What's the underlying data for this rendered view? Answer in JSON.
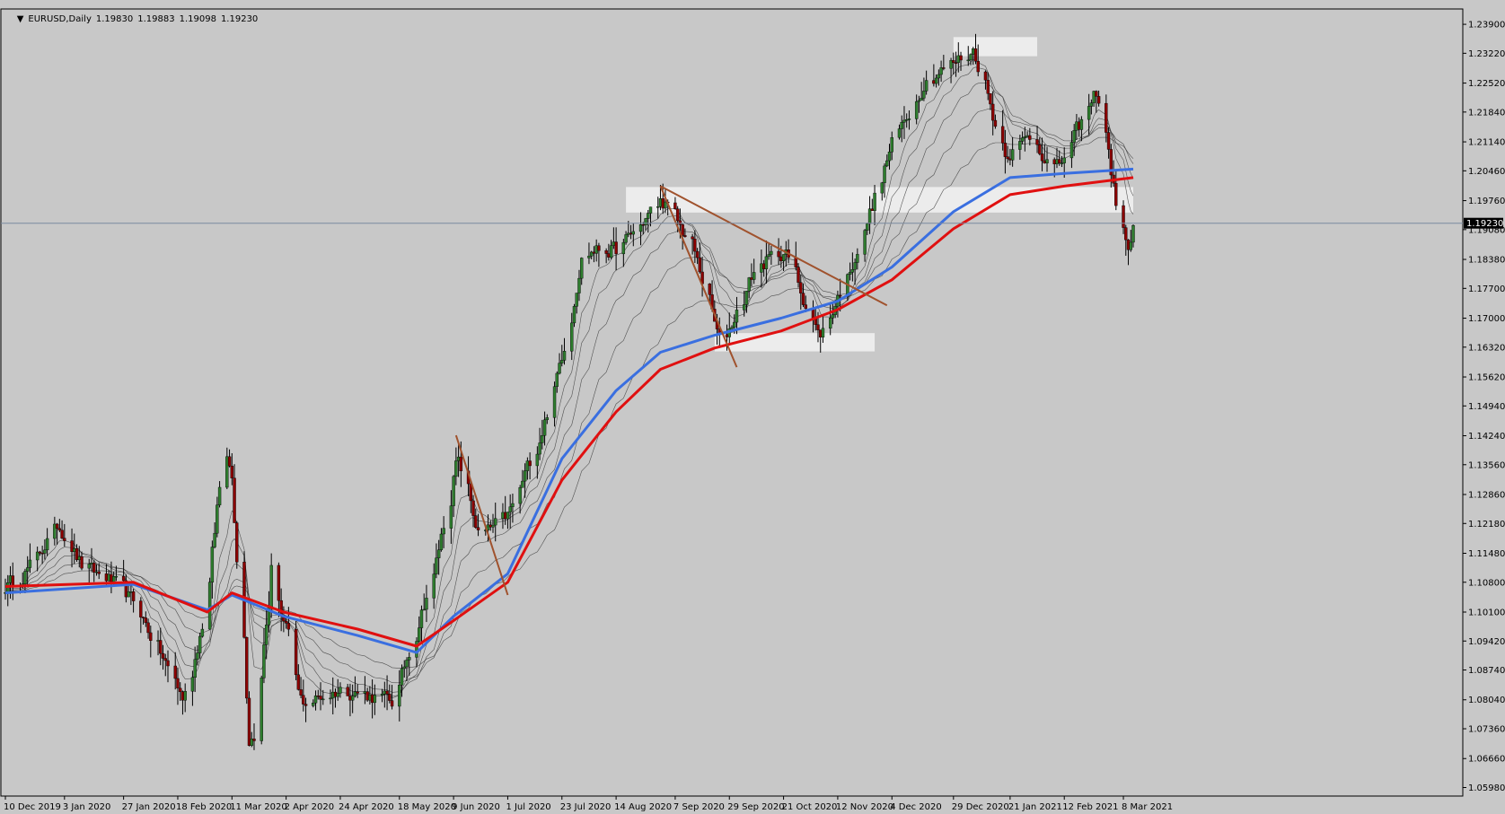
{
  "header": {
    "symbol": "EURUSD,Daily",
    "open": "1.19830",
    "high": "1.19883",
    "low": "1.19098",
    "close": "1.19230"
  },
  "colors": {
    "background": "#c8c8c8",
    "bull_candle": "#2e7d2e",
    "bear_candle": "#8b0000",
    "wick": "#000000",
    "ema_blue": "#3a6fe0",
    "ema_red": "#e01010",
    "ribbon": "#333333",
    "trendline": "#a0522d",
    "zone": "#ececec",
    "price_line": "#7a8aa0"
  },
  "chart_data": {
    "type": "candlestick",
    "title": "EURUSD,Daily",
    "ylim": [
      1.0578,
      1.2426
    ],
    "y_ticks": [
      "1.23900",
      "1.23220",
      "1.22520",
      "1.21840",
      "1.21140",
      "1.20460",
      "1.19760",
      "1.19080",
      "1.18380",
      "1.17700",
      "1.17000",
      "1.16320",
      "1.15620",
      "1.14940",
      "1.14240",
      "1.13560",
      "1.12860",
      "1.12180",
      "1.11480",
      "1.10800",
      "1.10100",
      "1.09420",
      "1.08740",
      "1.08040",
      "1.07360",
      "1.06660",
      "1.05980"
    ],
    "x_ticks": [
      "10 Dec 2019",
      "3 Jan 2020",
      "27 Jan 2020",
      "18 Feb 2020",
      "11 Mar 2020",
      "2 Apr 2020",
      "24 Apr 2020",
      "18 May 2020",
      "9 Jun 2020",
      "1 Jul 2020",
      "23 Jul 2020",
      "14 Aug 2020",
      "7 Sep 2020",
      "29 Sep 2020",
      "21 Oct 2020",
      "12 Nov 2020",
      "4 Dec 2020",
      "29 Dec 2020",
      "21 Jan 2021",
      "12 Feb 2021",
      "8 Mar 2021"
    ],
    "current_price": "1.19230",
    "price_path": [
      {
        "date": "10 Dec 2019",
        "price": 1.107
      },
      {
        "date": "20 Dec 2019",
        "price": 1.112
      },
      {
        "date": "31 Dec 2019",
        "price": 1.122
      },
      {
        "date": "10 Jan 2020",
        "price": 1.111
      },
      {
        "date": "20 Jan 2020",
        "price": 1.109
      },
      {
        "date": "31 Jan 2020",
        "price": 1.103
      },
      {
        "date": "20 Feb 2020",
        "price": 1.08
      },
      {
        "date": "28 Feb 2020",
        "price": 1.1
      },
      {
        "date": "09 Mar 2020",
        "price": 1.148
      },
      {
        "date": "18 Mar 2020",
        "price": 1.066
      },
      {
        "date": "27 Mar 2020",
        "price": 1.113
      },
      {
        "date": "06 Apr 2020",
        "price": 1.079
      },
      {
        "date": "24 Apr 2020",
        "price": 1.083
      },
      {
        "date": "15 May 2020",
        "price": 1.08
      },
      {
        "date": "01 Jun 2020",
        "price": 1.112
      },
      {
        "date": "10 Jun 2020",
        "price": 1.138
      },
      {
        "date": "19 Jun 2020",
        "price": 1.118
      },
      {
        "date": "01 Jul 2020",
        "price": 1.124
      },
      {
        "date": "15 Jul 2020",
        "price": 1.145
      },
      {
        "date": "23 Jul 2020",
        "price": 1.163
      },
      {
        "date": "31 Jul 2020",
        "price": 1.186
      },
      {
        "date": "14 Aug 2020",
        "price": 1.186
      },
      {
        "date": "01 Sep 2020",
        "price": 1.198
      },
      {
        "date": "14 Sep 2020",
        "price": 1.186
      },
      {
        "date": "25 Sep 2020",
        "price": 1.163
      },
      {
        "date": "09 Oct 2020",
        "price": 1.182
      },
      {
        "date": "21 Oct 2020",
        "price": 1.186
      },
      {
        "date": "04 Nov 2020",
        "price": 1.165
      },
      {
        "date": "20 Nov 2020",
        "price": 1.187
      },
      {
        "date": "04 Dec 2020",
        "price": 1.212
      },
      {
        "date": "17 Dec 2020",
        "price": 1.226
      },
      {
        "date": "06 Jan 2021",
        "price": 1.233
      },
      {
        "date": "18 Jan 2021",
        "price": 1.208
      },
      {
        "date": "29 Jan 2021",
        "price": 1.213
      },
      {
        "date": "08 Feb 2021",
        "price": 1.204
      },
      {
        "date": "25 Feb 2021",
        "price": 1.224
      },
      {
        "date": "04 Mar 2021",
        "price": 1.198
      },
      {
        "date": "09 Mar 2021",
        "price": 1.184
      },
      {
        "date": "12 Mar 2021",
        "price": 1.193
      }
    ],
    "ema_fast": [
      {
        "date": "10 Dec 2019",
        "price": 1.1055
      },
      {
        "date": "31 Jan 2020",
        "price": 1.1075
      },
      {
        "date": "01 Mar 2020",
        "price": 1.1015
      },
      {
        "date": "11 Mar 2020",
        "price": 1.105
      },
      {
        "date": "01 Apr 2020",
        "price": 1.1
      },
      {
        "date": "01 May 2020",
        "price": 1.0955
      },
      {
        "date": "25 May 2020",
        "price": 1.0915
      },
      {
        "date": "09 Jun 2020",
        "price": 1.1
      },
      {
        "date": "01 Jul 2020",
        "price": 1.11
      },
      {
        "date": "23 Jul 2020",
        "price": 1.137
      },
      {
        "date": "14 Aug 2020",
        "price": 1.153
      },
      {
        "date": "01 Sep 2020",
        "price": 1.162
      },
      {
        "date": "23 Sep 2020",
        "price": 1.166
      },
      {
        "date": "20 Oct 2020",
        "price": 1.17
      },
      {
        "date": "12 Nov 2020",
        "price": 1.174
      },
      {
        "date": "04 Dec 2020",
        "price": 1.182
      },
      {
        "date": "29 Dec 2020",
        "price": 1.195
      },
      {
        "date": "21 Jan 2021",
        "price": 1.203
      },
      {
        "date": "12 Feb 2021",
        "price": 1.204
      },
      {
        "date": "12 Mar 2021",
        "price": 1.205
      }
    ],
    "ema_slow": [
      {
        "date": "10 Dec 2019",
        "price": 1.107
      },
      {
        "date": "31 Jan 2020",
        "price": 1.108
      },
      {
        "date": "01 Mar 2020",
        "price": 1.101
      },
      {
        "date": "11 Mar 2020",
        "price": 1.1055
      },
      {
        "date": "01 Apr 2020",
        "price": 1.101
      },
      {
        "date": "01 May 2020",
        "price": 1.097
      },
      {
        "date": "25 May 2020",
        "price": 1.093
      },
      {
        "date": "09 Jun 2020",
        "price": 1.099
      },
      {
        "date": "01 Jul 2020",
        "price": 1.108
      },
      {
        "date": "23 Jul 2020",
        "price": 1.132
      },
      {
        "date": "14 Aug 2020",
        "price": 1.148
      },
      {
        "date": "01 Sep 2020",
        "price": 1.158
      },
      {
        "date": "23 Sep 2020",
        "price": 1.163
      },
      {
        "date": "20 Oct 2020",
        "price": 1.167
      },
      {
        "date": "12 Nov 2020",
        "price": 1.172
      },
      {
        "date": "04 Dec 2020",
        "price": 1.179
      },
      {
        "date": "29 Dec 2020",
        "price": 1.191
      },
      {
        "date": "21 Jan 2021",
        "price": 1.199
      },
      {
        "date": "12 Feb 2021",
        "price": 1.201
      },
      {
        "date": "12 Mar 2021",
        "price": 1.203
      }
    ],
    "zones": [
      {
        "from": "29 Dec 2020",
        "to": "01 Feb 2021",
        "high": 1.236,
        "low": 1.2315
      },
      {
        "from": "18 Aug 2020",
        "to": "12 Mar 2021",
        "high": 1.2008,
        "low": 1.1948
      },
      {
        "from": "23 Sep 2020",
        "to": "27 Nov 2020",
        "high": 1.1665,
        "low": 1.1622
      }
    ],
    "trendlines": [
      {
        "from": {
          "date": "10 Jun 2020",
          "price": 1.1425
        },
        "to": {
          "date": "01 Jul 2020",
          "price": 1.105
        }
      },
      {
        "from": {
          "date": "01 Sep 2020",
          "price": 1.201
        },
        "to": {
          "date": "02 Oct 2020",
          "price": 1.1585
        }
      },
      {
        "from": {
          "date": "01 Sep 2020",
          "price": 1.201
        },
        "to": {
          "date": "02 Dec 2020",
          "price": 1.173
        }
      }
    ]
  }
}
